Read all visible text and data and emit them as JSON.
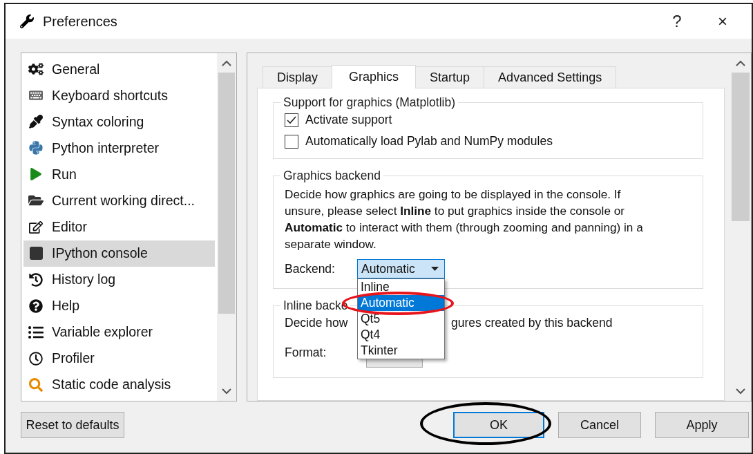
{
  "window": {
    "title": "Preferences",
    "help": "?",
    "close": "×"
  },
  "sidebar": {
    "items": [
      {
        "label": "General",
        "selected": false
      },
      {
        "label": "Keyboard shortcuts",
        "selected": false
      },
      {
        "label": "Syntax coloring",
        "selected": false
      },
      {
        "label": "Python interpreter",
        "selected": false
      },
      {
        "label": "Run",
        "selected": false
      },
      {
        "label": "Current working direct...",
        "selected": false
      },
      {
        "label": "Editor",
        "selected": false
      },
      {
        "label": "IPython console",
        "selected": true
      },
      {
        "label": "History log",
        "selected": false
      },
      {
        "label": "Help",
        "selected": false
      },
      {
        "label": "Variable explorer",
        "selected": false
      },
      {
        "label": "Profiler",
        "selected": false
      },
      {
        "label": "Static code analysis",
        "selected": false
      }
    ]
  },
  "tabs": [
    {
      "label": "Display",
      "selected": false
    },
    {
      "label": "Graphics",
      "selected": true
    },
    {
      "label": "Startup",
      "selected": false
    },
    {
      "label": "Advanced Settings",
      "selected": false
    }
  ],
  "support_group": {
    "title": "Support for graphics (Matplotlib)",
    "options": [
      {
        "label": "Activate support",
        "checked": true
      },
      {
        "label": "Automatically load Pylab and NumPy modules",
        "checked": false
      }
    ]
  },
  "backend_group": {
    "title": "Graphics backend",
    "description": "Decide how graphics are going to be displayed in the console. If unsure, please select **Inline** to put graphics inside the console or **Automatic** to interact with them (through zooming and panning) in a separate window.",
    "backend_label": "Backend:",
    "backend_value": "Automatic",
    "dropdown": [
      {
        "label": "Inline",
        "selected": false
      },
      {
        "label": "Automatic",
        "selected": true
      },
      {
        "label": "Qt5",
        "selected": false
      },
      {
        "label": "Qt4",
        "selected": false
      },
      {
        "label": "Tkinter",
        "selected": false
      }
    ]
  },
  "inline_group": {
    "title": "Inline backe",
    "description_start": "Decide how",
    "description_end": "gures created by this backend",
    "format_label": "Format:"
  },
  "buttons": {
    "reset": "Reset to defaults",
    "ok": "OK",
    "cancel": "Cancel",
    "apply": "Apply"
  },
  "annotations": [
    {
      "kind": "ellipse",
      "color": "#e8141b"
    },
    {
      "kind": "ellipse",
      "color": "#000000"
    }
  ]
}
